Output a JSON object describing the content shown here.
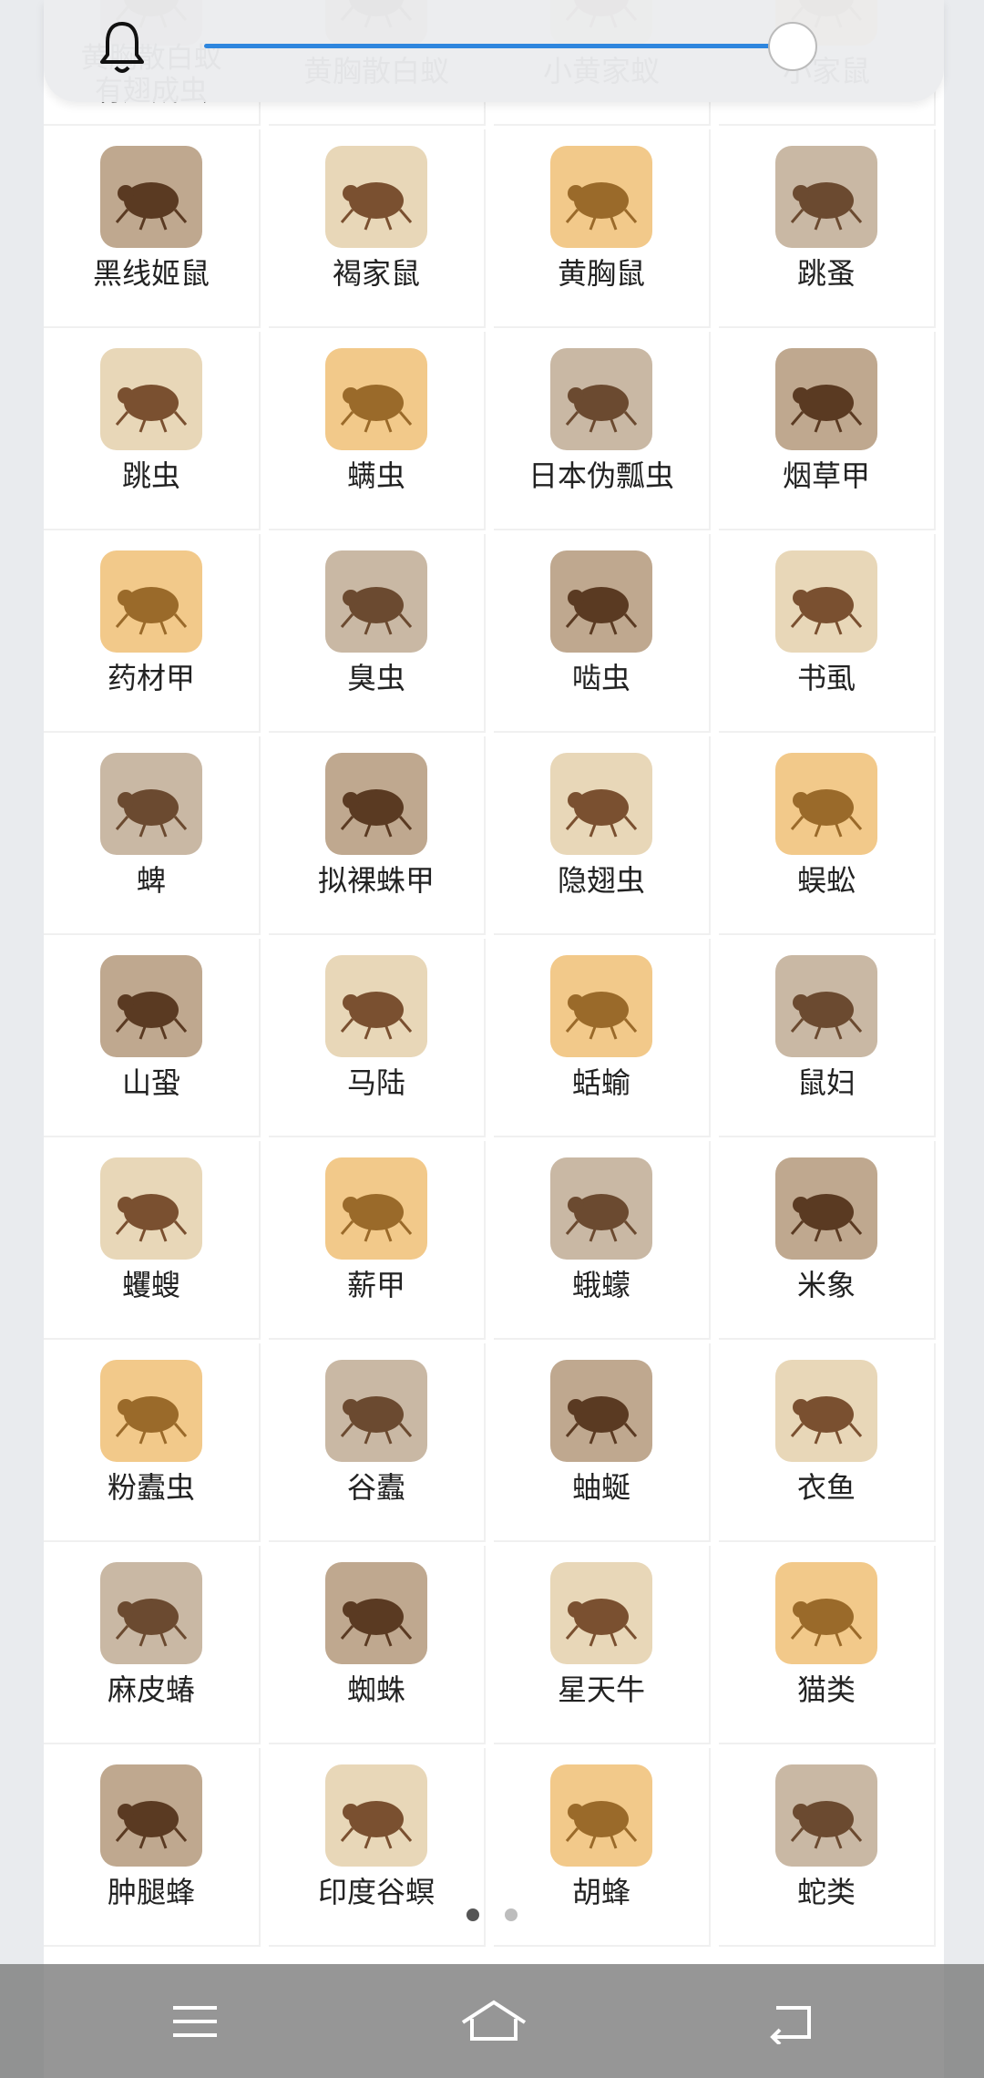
{
  "colors": {
    "accent": "#2e86de",
    "nav_bar": "#7a7a7a",
    "dot_active": "#555555",
    "dot_inactive": "#bdbdbd"
  },
  "notification_bar": {
    "bell_icon": "bell-icon",
    "slider_value": 1.0
  },
  "grid": {
    "rows": [
      [
        "黄胸散白蚁有翅成虫",
        "黄胸散白蚁",
        "小黄家蚁",
        "小家鼠"
      ],
      [
        "黑线姬鼠",
        "褐家鼠",
        "黄胸鼠",
        "跳蚤"
      ],
      [
        "跳虫",
        "螨虫",
        "日本伪瓢虫",
        "烟草甲"
      ],
      [
        "药材甲",
        "臭虫",
        "啮虫",
        "书虱"
      ],
      [
        "蜱",
        "拟裸蛛甲",
        "隐翅虫",
        "蜈蚣"
      ],
      [
        "山蛩",
        "马陆",
        "蛞蝓",
        "鼠妇"
      ],
      [
        "蠼螋",
        "薪甲",
        "蛾蠓",
        "米象"
      ],
      [
        "粉蠹虫",
        "谷蠹",
        "蚰蜒",
        "衣鱼"
      ],
      [
        "麻皮蝽",
        "蜘蛛",
        "星天牛",
        "猫类"
      ],
      [
        "肿腿蜂",
        "印度谷螟",
        "胡蜂",
        "蛇类"
      ]
    ],
    "first_label_lines": [
      "黄胸散白蚁",
      "有翅成虫"
    ]
  },
  "page_indicator": {
    "total": 2,
    "active": 1
  },
  "nav_bar": {
    "menu_icon": "menu-icon",
    "home_icon": "home-icon",
    "back_icon": "back-icon"
  }
}
